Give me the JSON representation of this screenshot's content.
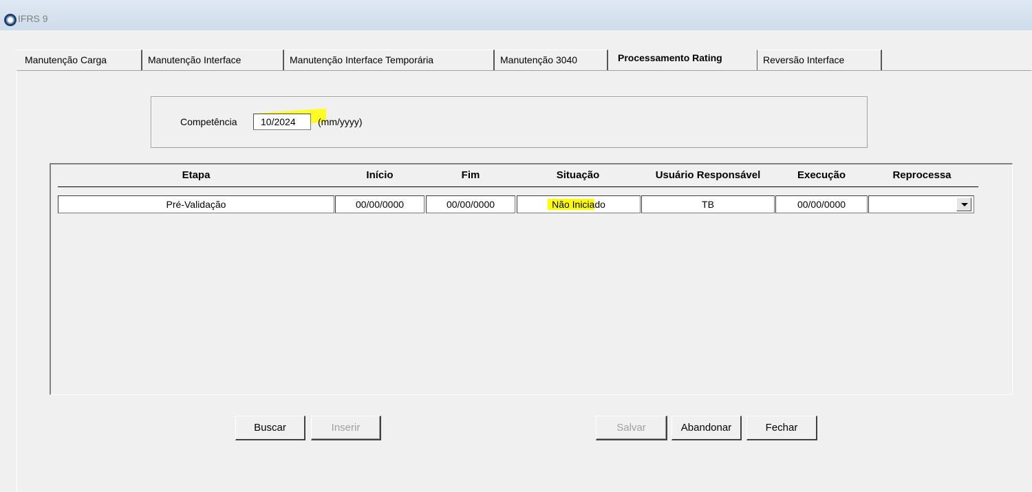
{
  "window": {
    "title": "IFRS 9"
  },
  "tabs": [
    {
      "label": "Manutenção Carga"
    },
    {
      "label": "Manutenção Interface"
    },
    {
      "label": "Manutenção Interface Temporária"
    },
    {
      "label": "Manutenção 3040"
    },
    {
      "label": "Processamento Rating"
    },
    {
      "label": "Reversão Interface"
    }
  ],
  "form": {
    "competencia_label": "Competência",
    "competencia_value": "10/2024",
    "competencia_hint": "(mm/yyyy)"
  },
  "grid": {
    "headers": [
      "Etapa",
      "Início",
      "Fim",
      "Situação",
      "Usuário Responsável",
      "Execução",
      "Reprocessa"
    ],
    "rows": [
      {
        "etapa": "Pré-Validação",
        "inicio": "00/00/0000",
        "fim": "00/00/0000",
        "situacao": "Não Iniciado",
        "usuario": "TB",
        "execucao": "00/00/0000",
        "reprocessa": ""
      }
    ]
  },
  "buttons": {
    "buscar": "Buscar",
    "inserir": "Inserir",
    "salvar": "Salvar",
    "abandonar": "Abandonar",
    "fechar": "Fechar"
  },
  "colors": {
    "highlight": "#ffff00",
    "titlebar": "#cfdceb"
  }
}
